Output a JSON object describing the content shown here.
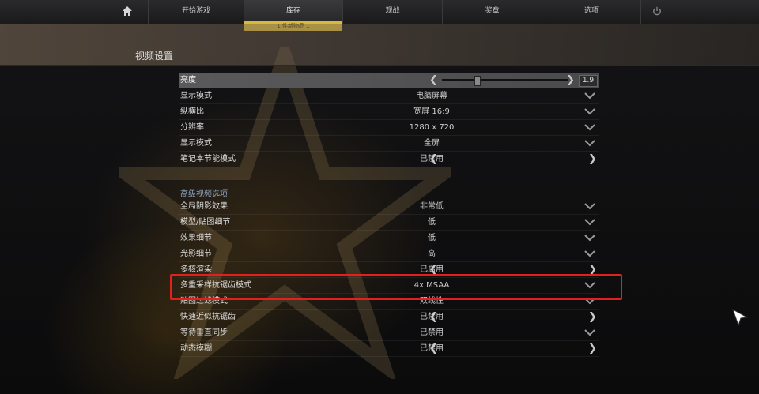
{
  "nav": {
    "items": [
      "开始游戏",
      "库存",
      "观战",
      "奖章",
      "选项"
    ],
    "badge": "1 件新物品 1"
  },
  "page": {
    "title": "视频设置"
  },
  "brightness": {
    "label": "亮度",
    "value": "1.9",
    "level": 0.28
  },
  "basic_rows": [
    {
      "label": "显示模式",
      "value": "电脑屏幕",
      "control": "dropdown"
    },
    {
      "label": "纵横比",
      "value": "宽屏 16:9",
      "control": "dropdown"
    },
    {
      "label": "分辨率",
      "value": "1280 x 720",
      "control": "dropdown"
    },
    {
      "label": "显示模式",
      "value": "全屏",
      "control": "dropdown"
    },
    {
      "label": "笔记本节能模式",
      "value": "已禁用",
      "control": "toggle"
    }
  ],
  "advanced": {
    "heading": "高级视频选项",
    "rows": [
      {
        "label": "全局阴影效果",
        "value": "非常低",
        "control": "dropdown"
      },
      {
        "label": "模型/贴图细节",
        "value": "低",
        "control": "dropdown"
      },
      {
        "label": "效果细节",
        "value": "低",
        "control": "dropdown"
      },
      {
        "label": "光影细节",
        "value": "高",
        "control": "dropdown"
      },
      {
        "label": "多核渲染",
        "value": "已启用",
        "control": "toggle"
      },
      {
        "label": "多重采样抗锯齿模式",
        "value": "4x MSAA",
        "control": "dropdown"
      },
      {
        "label": "贴图过滤模式",
        "value": "双线性",
        "control": "dropdown"
      },
      {
        "label": "快速近似抗锯齿",
        "value": "已禁用",
        "control": "toggle"
      },
      {
        "label": "等待垂直同步",
        "value": "已禁用",
        "control": "dropdown"
      },
      {
        "label": "动态模糊",
        "value": "已禁用",
        "control": "toggle"
      }
    ]
  },
  "icons": {
    "home": "home-icon",
    "power": "power-icon",
    "left": "arrow-left-icon",
    "right": "arrow-right-icon",
    "dropdown": "chevron-down-icon",
    "cursor": "mouse-cursor-icon"
  },
  "colors": {
    "highlight": "#e0211f",
    "badge": "#d8b93a",
    "section_heading": "#8fa7c4"
  }
}
